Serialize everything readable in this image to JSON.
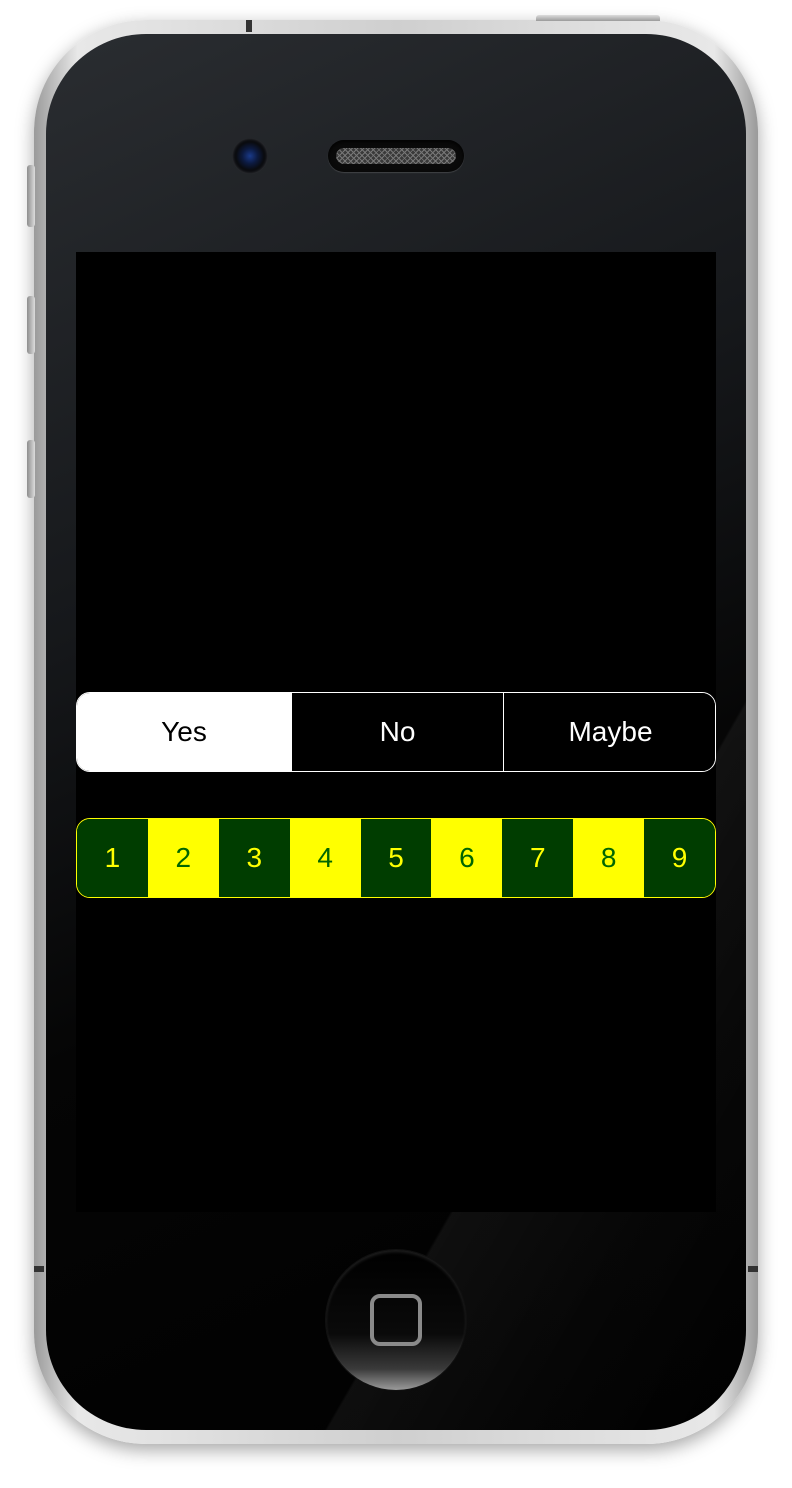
{
  "device": {
    "model": "iPhone",
    "screen_background": "#000000"
  },
  "segmented_control": {
    "segments": [
      {
        "label": "Yes",
        "selected": true
      },
      {
        "label": "No",
        "selected": false
      },
      {
        "label": "Maybe",
        "selected": false
      }
    ],
    "border_color": "#ffffff",
    "selected_background": "#ffffff"
  },
  "number_picker": {
    "items": [
      "1",
      "2",
      "3",
      "4",
      "5",
      "6",
      "7",
      "8",
      "9"
    ],
    "odd_background": "#003d00",
    "odd_text": "#ffff00",
    "even_background": "#ffff00",
    "even_text": "#006600",
    "border_color": "#ffff00"
  },
  "icons": {
    "camera": "front-camera-icon",
    "speaker": "earpiece-speaker-icon",
    "home": "home-button-icon"
  }
}
